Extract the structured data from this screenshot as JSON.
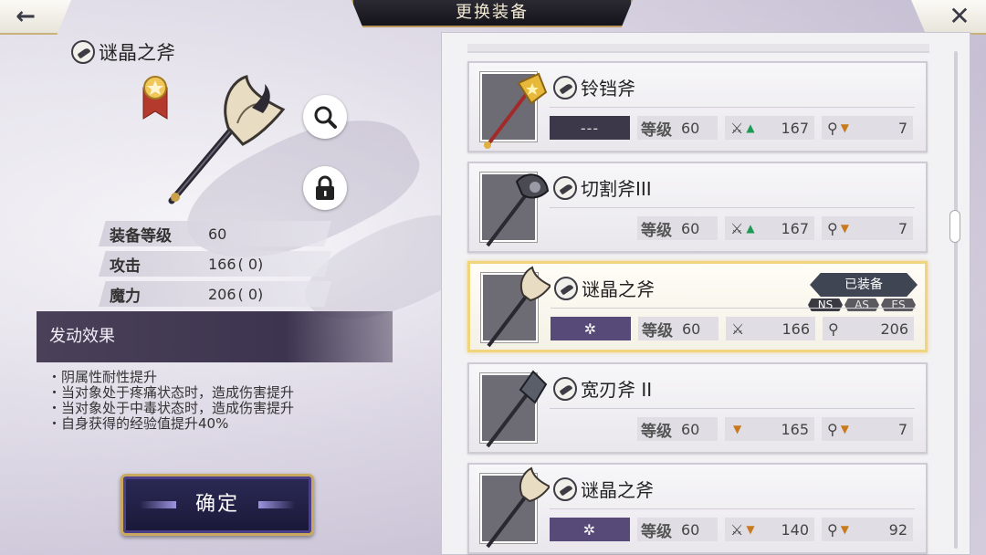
{
  "header": {
    "title": "更换装备",
    "back_icon": "back-arrow-icon",
    "close_icon": "close-icon"
  },
  "detail": {
    "name": "谜晶之斧",
    "stats": [
      {
        "label": "装备等级",
        "value": "60",
        "extra": ""
      },
      {
        "label": "攻击",
        "value": "166",
        "extra": "(        0)"
      },
      {
        "label": "魔力",
        "value": "206",
        "extra": "(        0)"
      }
    ],
    "effect_title": "发动效果",
    "effects": [
      "・阴属性耐性提升",
      "・当对象处于疼痛状态时，造成伤害提升",
      "・当对象处于中毒状态时，造成伤害提升",
      "・自身获得的经验值提升40%"
    ],
    "confirm_label": "确定"
  },
  "equipment_list": [
    {
      "name": "铃铛斧",
      "rune": "---",
      "level_label": "等级",
      "level": "60",
      "atk": "167",
      "atk_trend": "up",
      "mag": "7",
      "mag_trend": "down",
      "equipped": false
    },
    {
      "name": "切割斧III",
      "rune": "",
      "level_label": "等级",
      "level": "60",
      "atk": "167",
      "atk_trend": "up",
      "mag": "7",
      "mag_trend": "down",
      "equipped": false
    },
    {
      "name": "谜晶之斧",
      "rune": "✲",
      "level_label": "等级",
      "level": "60",
      "atk": "166",
      "atk_trend": "",
      "mag": "206",
      "mag_trend": "",
      "equipped": true,
      "equipped_label": "已装备",
      "rune_tags": [
        "NS",
        "AS",
        "ES"
      ]
    },
    {
      "name": "宽刃斧 II",
      "rune": "",
      "level_label": "等级",
      "level": "60",
      "atk": "165",
      "atk_trend": "down",
      "mag": "7",
      "mag_trend": "down",
      "equipped": false
    },
    {
      "name": "谜晶之斧",
      "rune": "✲",
      "level_label": "等级",
      "level": "60",
      "atk": "140",
      "atk_trend": "down",
      "mag": "92",
      "mag_trend": "down",
      "equipped": false
    }
  ]
}
